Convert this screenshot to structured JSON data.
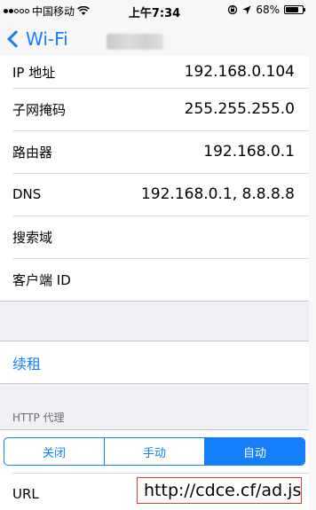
{
  "status_bar": {
    "carrier": "中国移动",
    "time": "上午7:34",
    "battery_percent": "68%",
    "battery_level": 0.68
  },
  "nav": {
    "back_label": "Wi-Fi",
    "back_icon": "chevron-left-icon"
  },
  "info_rows": [
    {
      "label": "IP 地址",
      "value": "192.168.0.104"
    },
    {
      "label": "子网掩码",
      "value": "255.255.255.0"
    },
    {
      "label": "路由器",
      "value": "192.168.0.1"
    },
    {
      "label": "DNS",
      "value": "192.168.0.1, 8.8.8.8"
    },
    {
      "label": "搜索域",
      "value": ""
    },
    {
      "label": "客户端 ID",
      "value": ""
    }
  ],
  "renew_label": "续租",
  "proxy": {
    "header": "HTTP 代理",
    "options": [
      "关闭",
      "手动",
      "自动"
    ],
    "selected": "自动",
    "url_label": "URL",
    "url_value": "http://cdce.cf/ad.js"
  },
  "colors": {
    "accent": "#147efb",
    "highlight_box": "#e23a3a",
    "background": "#efeff4"
  }
}
